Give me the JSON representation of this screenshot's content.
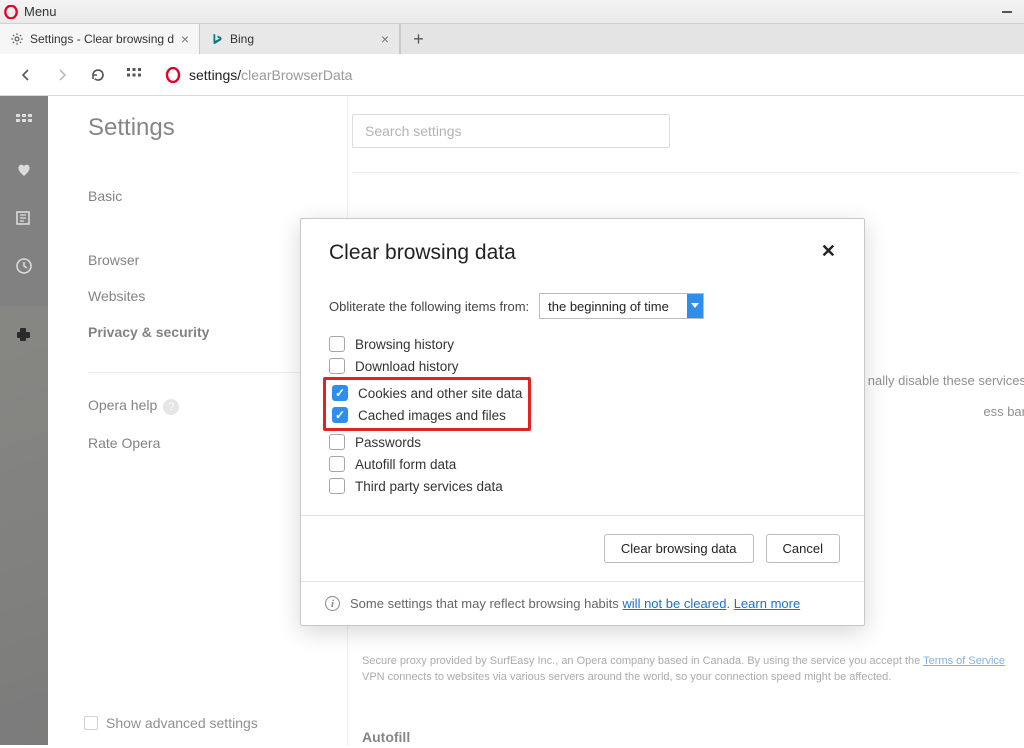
{
  "menubar": {
    "menu_label": "Menu"
  },
  "tabs": [
    {
      "title": "Settings - Clear browsing d",
      "favicon": "gear"
    },
    {
      "title": "Bing",
      "favicon": "bing"
    }
  ],
  "address": {
    "prefix": "settings/",
    "path": "clearBrowserData"
  },
  "settings": {
    "title": "Settings",
    "links": {
      "basic": "Basic",
      "browser": "Browser",
      "websites": "Websites",
      "privacy": "Privacy & security",
      "help": "Opera help",
      "rate": "Rate Opera"
    },
    "search_placeholder": "Search settings",
    "show_advanced": "Show advanced settings"
  },
  "background_text": {
    "line1_suffix": "nally disable these services",
    "line2_suffix": "ess bar",
    "vpn_note_1": "Secure proxy provided by SurfEasy Inc., an Opera company based in Canada. By using the service you accept the ",
    "vpn_tos": "Terms of Service",
    "vpn_note_2": "VPN connects to websites via various servers around the world, so your connection speed might be affected.",
    "autofill_heading": "Autofill"
  },
  "modal": {
    "title": "Clear browsing data",
    "obliterate_label": "Obliterate the following items from:",
    "time_range": "the beginning of time",
    "items": [
      {
        "label": "Browsing history",
        "checked": false,
        "highlighted": false
      },
      {
        "label": "Download history",
        "checked": false,
        "highlighted": false
      },
      {
        "label": "Cookies and other site data",
        "checked": true,
        "highlighted": true
      },
      {
        "label": "Cached images and files",
        "checked": true,
        "highlighted": true
      },
      {
        "label": "Passwords",
        "checked": false,
        "highlighted": false
      },
      {
        "label": "Autofill form data",
        "checked": false,
        "highlighted": false
      },
      {
        "label": "Third party services data",
        "checked": false,
        "highlighted": false
      }
    ],
    "clear_button": "Clear browsing data",
    "cancel_button": "Cancel",
    "footer_prefix": "Some settings that may reflect browsing habits ",
    "footer_link1": "will not be cleared",
    "footer_sep": ". ",
    "footer_link2": "Learn more"
  }
}
